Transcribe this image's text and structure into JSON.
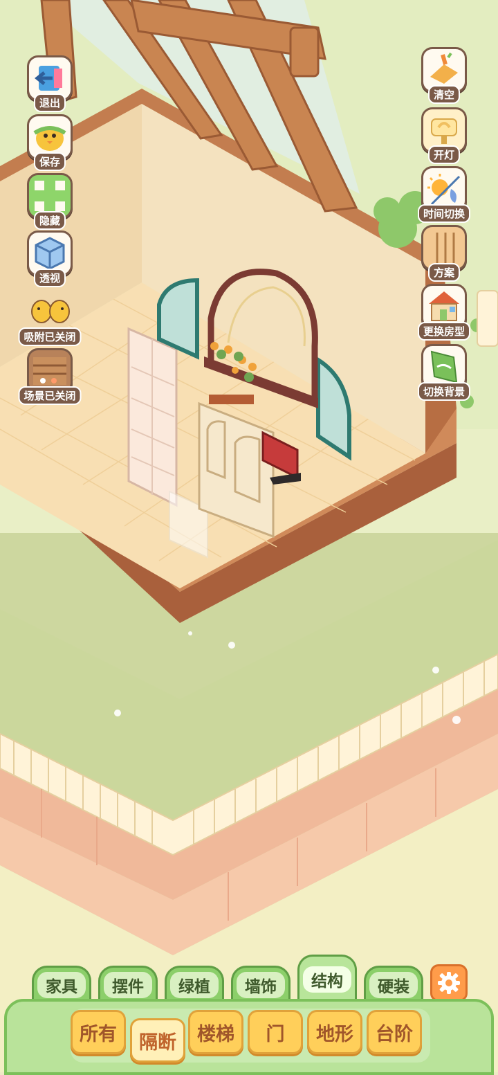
{
  "left_tools": [
    {
      "id": "exit",
      "label": "退出",
      "icon": "exit-door-icon"
    },
    {
      "id": "save",
      "label": "保存",
      "icon": "duck-save-icon"
    },
    {
      "id": "hide",
      "label": "隐藏",
      "icon": "hide-frame-icon"
    },
    {
      "id": "perspective",
      "label": "透视",
      "icon": "cube-perspective-icon"
    },
    {
      "id": "snap",
      "label": "吸附已关闭",
      "icon": "two-ducks-snap-icon"
    },
    {
      "id": "scene",
      "label": "场景已关闭",
      "icon": "scene-box-icon"
    }
  ],
  "right_tools": [
    {
      "id": "clear",
      "label": "清空",
      "icon": "broom-clear-icon"
    },
    {
      "id": "light",
      "label": "开灯",
      "icon": "lamp-icon"
    },
    {
      "id": "time",
      "label": "时间切换",
      "icon": "sun-moon-icon"
    },
    {
      "id": "plan",
      "label": "方案",
      "icon": "blueprint-icon"
    },
    {
      "id": "room",
      "label": "更换房型",
      "icon": "house-icon"
    },
    {
      "id": "bg",
      "label": "切换背景",
      "icon": "background-flag-icon"
    }
  ],
  "category_tabs": [
    "家具",
    "摆件",
    "绿植",
    "墙饰",
    "结构",
    "硬装"
  ],
  "active_category": "结构",
  "sub_tabs": [
    "所有",
    "隔断",
    "楼梯",
    "门",
    "地形",
    "台阶"
  ],
  "active_sub_tab": "隔断",
  "settings_icon": "gear-icon",
  "colors": {
    "tab_green": "#8ccf6a",
    "panel_green": "#b9e39a",
    "sub_tab_yellow": "#ffcf5a",
    "settings_orange": "#ff9c4a",
    "wall_cream": "#f4e2bf",
    "floor_tan": "#f7dfb2",
    "lawn_green": "#cfd9a0",
    "wood_brown": "#b8734a"
  }
}
